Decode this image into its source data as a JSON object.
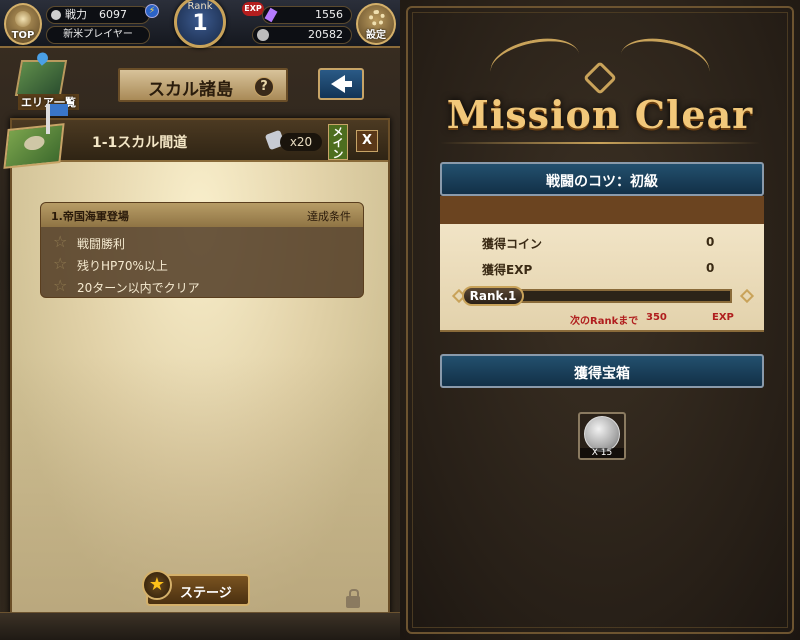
{
  "left_panel": {
    "hud": {
      "top_label": "TOP",
      "power_label": "戦力",
      "power_value": "6097",
      "player_name": "新米プレイヤー",
      "rank_label": "Rank",
      "rank_value": "1",
      "exp_badge": "EXP",
      "gems": "1556",
      "coins": "20582",
      "settings_label": "設定"
    },
    "area_list_label": "エリア一覧",
    "island_title": "スカル諸島",
    "help_symbol": "?",
    "stage_modal": {
      "stage_title": "1-1スカル間道",
      "reward_count": "x20",
      "main_tag": "メイン",
      "close_symbol": "X",
      "mission": {
        "name": "1.帝国海軍登場",
        "condition_header": "達成条件",
        "conditions": [
          "戦闘勝利",
          "残りHP70%以上",
          "20ターン以内でクリア"
        ]
      },
      "stage_button": "ステージ"
    }
  },
  "right_panel": {
    "title": "Mission Clear",
    "mission_name": "戦闘のコツ：初級",
    "rewards": [
      {
        "label": "獲得コイン",
        "value": "0"
      },
      {
        "label": "獲得EXP",
        "value": "0"
      }
    ],
    "rank_label": "Rank.1",
    "rank_progress": 0,
    "next_rank": {
      "label": "次のRankまで",
      "value": "350",
      "unit": "EXP"
    },
    "treasure_header": "獲得宝箱",
    "treasure_item": {
      "icon": "silver-coin-icon",
      "count": "X 15"
    }
  },
  "colors": {
    "accent_gold": "#c9a35a",
    "banner_blue": "#23506e",
    "exp_red": "#b01e1e"
  }
}
